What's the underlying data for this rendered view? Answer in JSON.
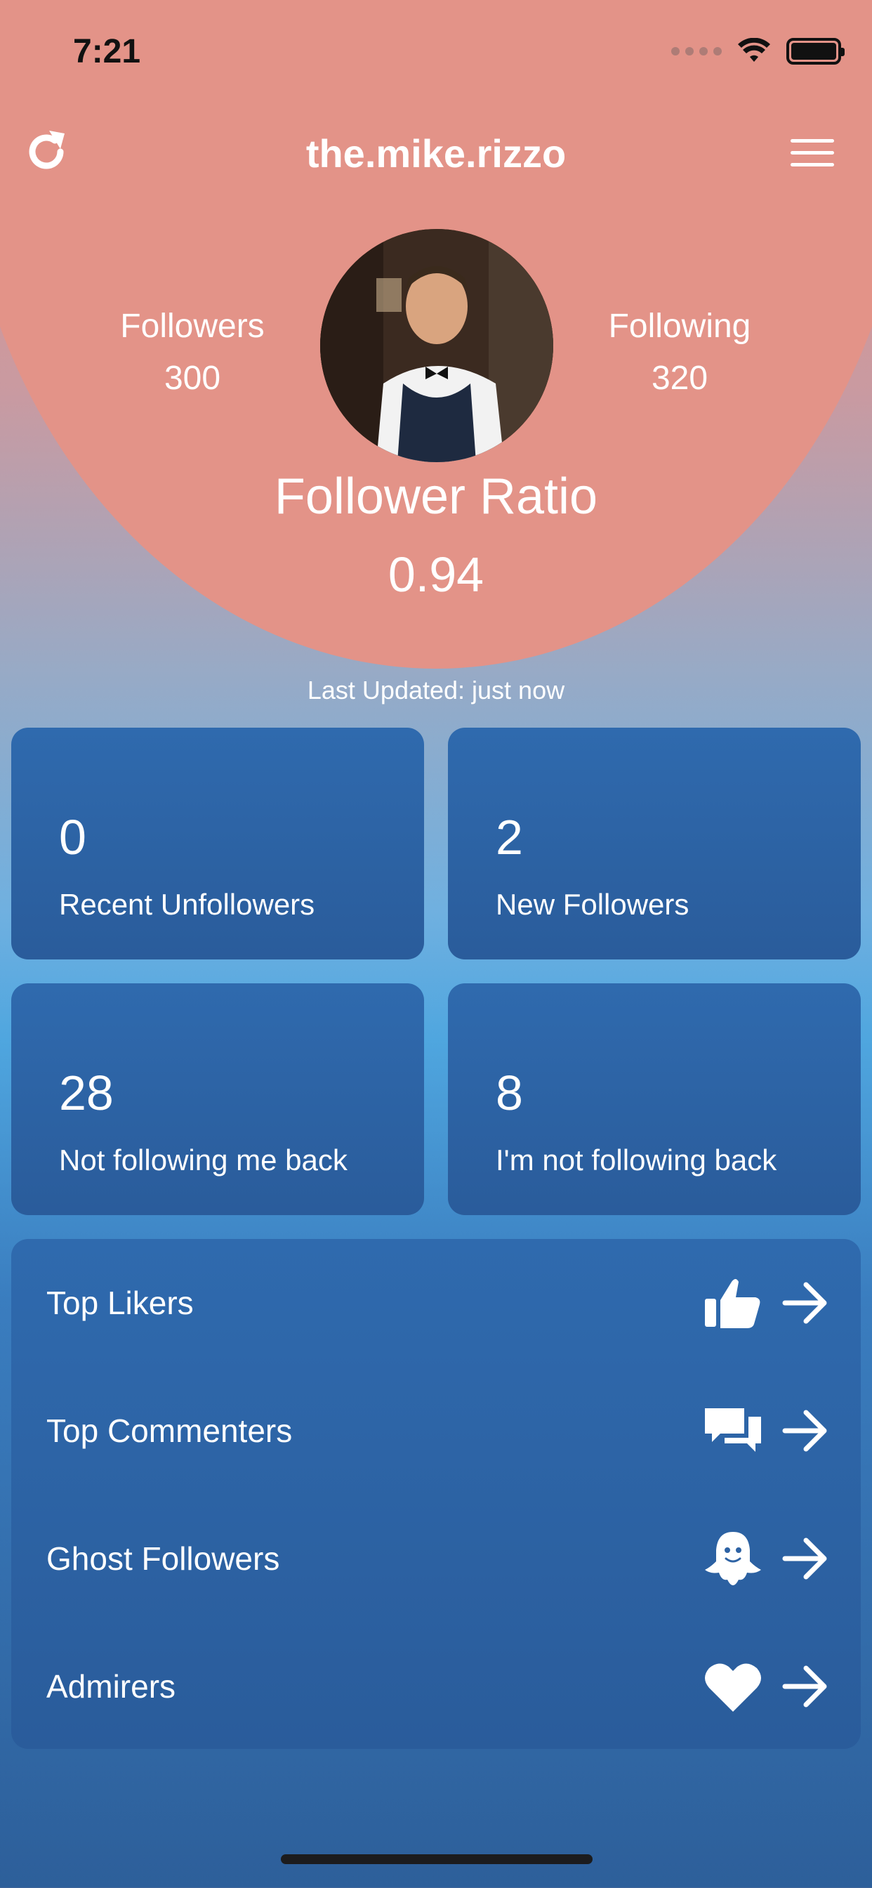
{
  "status_bar": {
    "time": "7:21"
  },
  "header": {
    "username": "the.mike.rizzo",
    "refresh_icon": "refresh-icon",
    "menu_icon": "menu-icon"
  },
  "profile": {
    "followers_label": "Followers",
    "followers_value": "300",
    "following_label": "Following",
    "following_value": "320",
    "ratio_label": "Follower Ratio",
    "ratio_value": "0.94",
    "last_updated": "Last Updated: just now"
  },
  "cards": [
    {
      "value": "0",
      "label": "Recent Unfollowers"
    },
    {
      "value": "2",
      "label": "New Followers"
    },
    {
      "value": "28",
      "label": "Not following me back"
    },
    {
      "value": "8",
      "label": "I'm not following back"
    }
  ],
  "list": [
    {
      "label": "Top Likers",
      "icon": "thumbs-up-icon"
    },
    {
      "label": "Top Commenters",
      "icon": "chat-bubbles-icon"
    },
    {
      "label": "Ghost Followers",
      "icon": "ghost-icon"
    },
    {
      "label": "Admirers",
      "icon": "heart-icon"
    }
  ],
  "colors": {
    "header_bg": "#e39388",
    "card_bg": "#2f6aae",
    "text": "#ffffff"
  }
}
